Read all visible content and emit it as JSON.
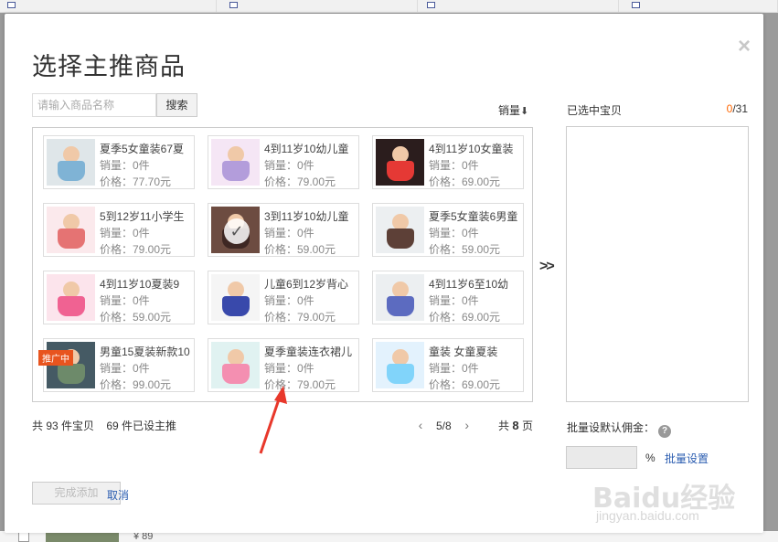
{
  "dialog": {
    "title": "选择主推商品",
    "close_glyph": "×",
    "search_placeholder": "请输入商品名称",
    "search_button": "搜索",
    "sort_label": "销量",
    "sort_arrow": "⬇",
    "move_glyph": ">>"
  },
  "products": [
    {
      "name": "夏季5女童装67夏",
      "sales": "销量：0件",
      "price": "价格：77.70元",
      "colors": [
        "#dfe6e9",
        "#7fb3d5"
      ]
    },
    {
      "name": "4到11岁10幼儿童",
      "sales": "销量：0件",
      "price": "价格：79.00元",
      "colors": [
        "#f5e6f5",
        "#b39ddb"
      ]
    },
    {
      "name": "4到11岁10女童装",
      "sales": "销量：0件",
      "price": "价格：69.00元",
      "colors": [
        "#2b1d1d",
        "#e53935"
      ]
    },
    {
      "name": "5到12岁11小学生",
      "sales": "销量：0件",
      "price": "价格：79.00元",
      "colors": [
        "#fbe9ec",
        "#e57373"
      ]
    },
    {
      "name": "3到11岁10幼儿童",
      "sales": "销量：0件",
      "price": "价格：59.00元",
      "colors": [
        "#6d4c41",
        "#3e2723"
      ],
      "selected": true
    },
    {
      "name": "夏季5女童装6男童",
      "sales": "销量：0件",
      "price": "价格：59.00元",
      "colors": [
        "#eceff1",
        "#5d4037"
      ]
    },
    {
      "name": "4到11岁10夏装9",
      "sales": "销量：0件",
      "price": "价格：59.00元",
      "colors": [
        "#fce4ec",
        "#f06292"
      ]
    },
    {
      "name": "儿童6到12岁背心",
      "sales": "销量：0件",
      "price": "价格：79.00元",
      "colors": [
        "#f5f5f5",
        "#3949ab"
      ]
    },
    {
      "name": "4到11岁6至10幼",
      "sales": "销量：0件",
      "price": "价格：69.00元",
      "colors": [
        "#eceff1",
        "#5c6bc0"
      ]
    },
    {
      "name": "男童15夏装新款10",
      "sales": "销量：0件",
      "price": "价格：99.00元",
      "colors": [
        "#455a64",
        "#6d8a6a"
      ],
      "promo": "推广中"
    },
    {
      "name": "夏季童装连衣裙儿",
      "sales": "销量：0件",
      "price": "价格：79.00元",
      "colors": [
        "#e0f2f1",
        "#f48fb1"
      ]
    },
    {
      "name": "童装 女童夏装",
      "sales": "销量：0件",
      "price": "价格：69.00元",
      "colors": [
        "#e3f2fd",
        "#81d4fa"
      ]
    }
  ],
  "footer": {
    "total_text": "共 93 件宝贝    69 件已设主推",
    "page_prev": "‹",
    "page_current": "5/8",
    "page_next": "›",
    "total_pages_prefix": "共",
    "total_pages_num": "8",
    "total_pages_suffix": "页"
  },
  "selected_panel": {
    "label": "已选中宝贝",
    "count_current": "0",
    "count_sep_max": "/31"
  },
  "commission": {
    "label": "批量设默认佣金：",
    "help_glyph": "?",
    "percent": "%",
    "batch_link": "批量设置"
  },
  "actions": {
    "done": "完成添加",
    "cancel": "取消"
  },
  "background": {
    "bottom_price": "¥ 89"
  },
  "watermark": {
    "logo": "Baidu经验",
    "url": "jingyan.baidu.com"
  },
  "colors": {
    "link": "#2a5cb0",
    "accent_orange": "#f60",
    "annotation_red": "#e8382b",
    "promo_bg": "#e8541e"
  }
}
